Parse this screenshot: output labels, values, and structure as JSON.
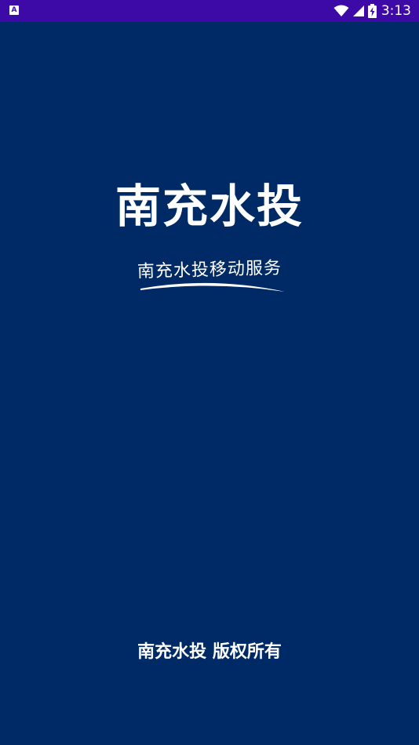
{
  "status_bar": {
    "left_icon": "A",
    "time": "3:13",
    "icons": [
      "notification-a-icon",
      "wifi-icon",
      "cell-signal-icon",
      "battery-charging-icon"
    ]
  },
  "splash": {
    "title": "南充水投",
    "slogan": "南充水投移动服务",
    "copyright": "南充水投 版权所有"
  },
  "colors": {
    "background": "#002a65",
    "status_bar": "#3d0aa8",
    "text": "#ffffff"
  }
}
